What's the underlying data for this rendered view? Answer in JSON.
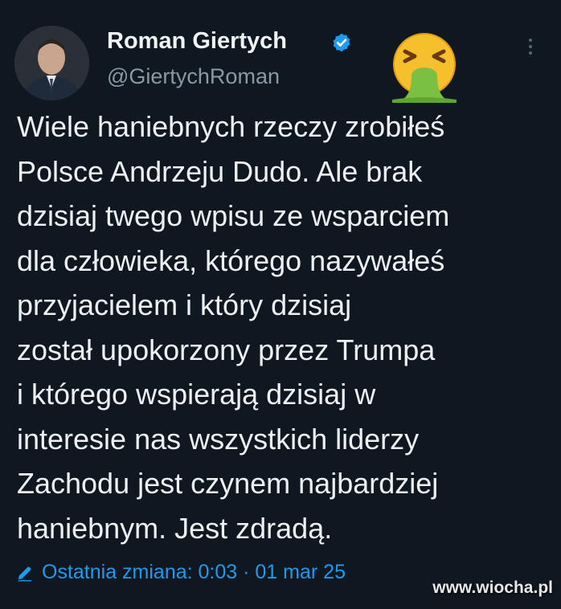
{
  "author": {
    "name": "Roman Giertych",
    "handle": "@GiertychRoman",
    "verified": true
  },
  "icons": {
    "verified": "verified-badge-icon",
    "emoji": "vomiting-face-emoji",
    "more": "more-options-icon",
    "edit": "pencil-icon"
  },
  "tweet": {
    "lines": [
      "Wiele haniebnych rzeczy zrobiłeś",
      "Polsce Andrzeju Dudo. Ale brak",
      "dzisiaj twego wpisu ze wsparciem",
      "dla człowieka, którego nazywałeś",
      "przyjacielem i który dzisiaj",
      "został upokorzony przez Trumpa",
      "i którego wspierają dzisiaj w",
      "interesie nas wszystkich liderzy",
      "Zachodu jest czynem najbardziej",
      "haniebnym. Jest zdradą."
    ]
  },
  "edited_label": "Ostatnia zmiana: 0:03 · 01 mar 25",
  "watermark": "www.wiocha.pl",
  "colors": {
    "background": "#0f1720",
    "text": "#eef1f3",
    "secondary": "#8b98a5",
    "accent": "#1d9bf0"
  }
}
